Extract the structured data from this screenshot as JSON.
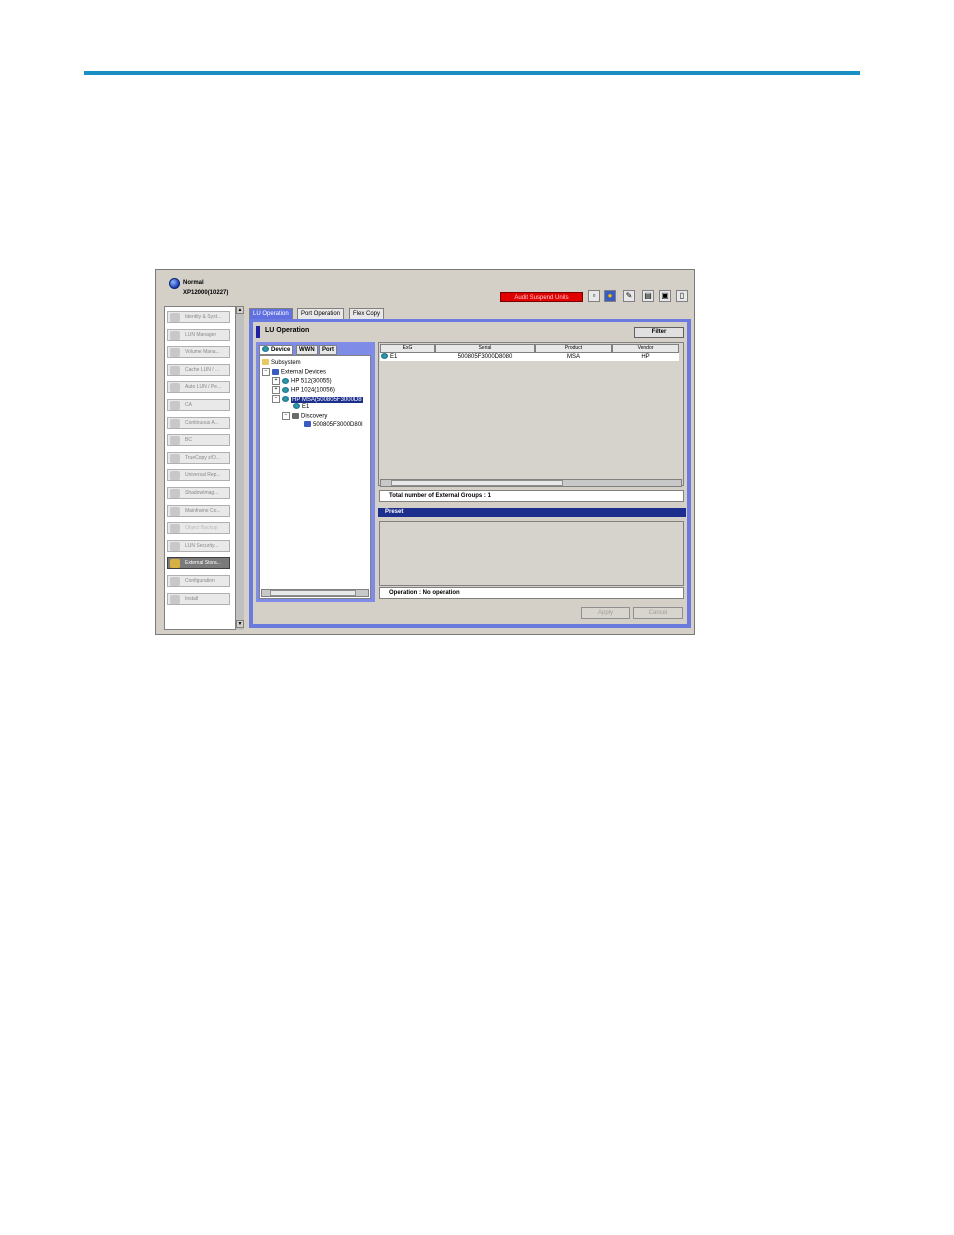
{
  "header": {
    "status": "Normal",
    "system": "XP12000(10227)",
    "alert_button": "Audit Suspend Units"
  },
  "nav": {
    "items": [
      {
        "label": "Identity & Syst..."
      },
      {
        "label": "LUN Manager"
      },
      {
        "label": "Volume Mana..."
      },
      {
        "label": "Cache LUN / ..."
      },
      {
        "label": "Auto LUN / Pe..."
      },
      {
        "label": "CA"
      },
      {
        "label": "Continuous A..."
      },
      {
        "label": "BC"
      },
      {
        "label": "TrueCopy z/O..."
      },
      {
        "label": "Universal Rep..."
      },
      {
        "label": "ShadowImag..."
      },
      {
        "label": "Mainframe Co..."
      },
      {
        "label": "Object Backup"
      },
      {
        "label": "LUN Security..."
      },
      {
        "label": "External Stora..."
      },
      {
        "label": "Configuration"
      },
      {
        "label": "Install"
      }
    ]
  },
  "tabs": [
    "LU Operation",
    "Port Operation",
    "Flex Copy"
  ],
  "panel": {
    "title": "LU Operation",
    "filter": "Filter"
  },
  "tree_tabs": [
    "Device",
    "WWN",
    "Port"
  ],
  "tree": {
    "subsystem": "Subsystem",
    "external_devices": "External Devices",
    "dev1": "HP 512(30055)",
    "dev2": "HP 1024(10056)",
    "dev3": "HP MSA(500805F3000D8",
    "e1": "E1",
    "discovery": "Discovery",
    "disc_item": "500805F3000D80I"
  },
  "table": {
    "headers": [
      "ExG",
      "Serial",
      "Product",
      "Vendor"
    ],
    "row": {
      "exg": "E1",
      "serial": "500805F3000D8080",
      "product": "MSA",
      "vendor": "HP"
    }
  },
  "summary": "Total number of External Groups : 1",
  "preset": "Preset",
  "operation": "Operation : No operation",
  "buttons": {
    "apply": "Apply",
    "cancel": "Cancel"
  }
}
